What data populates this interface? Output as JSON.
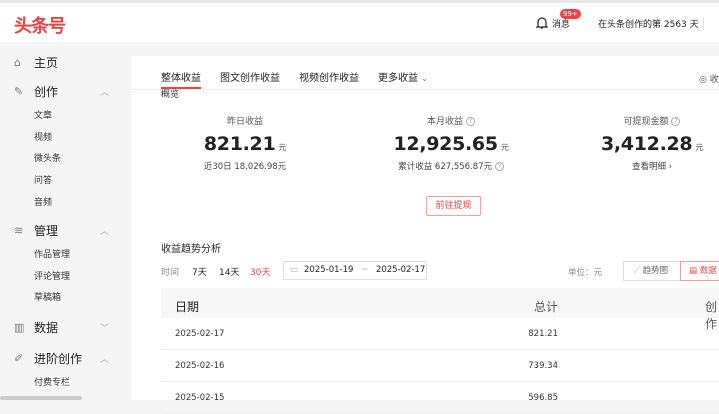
{
  "header": {
    "logo": "头条号",
    "messages": "消息",
    "badge": "99+",
    "days": "在头条创作的第 2563 天"
  },
  "sidebar": {
    "items": [
      {
        "label": "主页",
        "icon": "home-icon",
        "glyph": "⌂"
      },
      {
        "label": "创作",
        "icon": "pen-icon",
        "glyph": "✎",
        "chev": "︿",
        "subs": [
          "文章",
          "视频",
          "微头条",
          "问答",
          "音频"
        ]
      },
      {
        "label": "管理",
        "icon": "layers-icon",
        "glyph": "≋",
        "chev": "︿",
        "subs": [
          "作品管理",
          "评论管理",
          "草稿箱"
        ]
      },
      {
        "label": "数据",
        "icon": "bar-chart-icon",
        "glyph": "▥",
        "chev": "﹀"
      },
      {
        "label": "进阶创作",
        "icon": "edit-doc-icon",
        "glyph": "✐",
        "chev": "︿",
        "subs": [
          "付费专栏"
        ]
      }
    ]
  },
  "tabs": [
    "整体收益",
    "图文创作收益",
    "视频创作收益",
    "更多收益"
  ],
  "more_chev": "⌄",
  "right_top": "◎ 收",
  "overview": "概览",
  "stats": [
    {
      "label": "昨日收益",
      "value": "821.21",
      "unit": "元",
      "sub": "近30日 18,026.98元"
    },
    {
      "label": "本月收益",
      "value": "12,925.65",
      "unit": "元",
      "sub": "累计收益 627,556.87元"
    },
    {
      "label": "可提现金额",
      "value": "3,412.28",
      "unit": "元",
      "sub": "查看明细 ›"
    }
  ],
  "withdraw_button": "前往提现",
  "trend": {
    "title": "收益趋势分析",
    "time_label": "时间",
    "ranges": [
      "7天",
      "14天",
      "30天"
    ],
    "active_range": "30天",
    "start": "2025-01-19",
    "sep": "~",
    "end": "2025-02-17",
    "unit": "单位：元",
    "chart_view": "趋势图",
    "data_view": "数据"
  },
  "table": {
    "headers": [
      "日期",
      "总计",
      "创作"
    ],
    "rows": [
      [
        "2025-02-17",
        "821.21"
      ],
      [
        "2025-02-16",
        "739.34"
      ],
      [
        "2025-02-15",
        "596.85"
      ]
    ]
  },
  "colors": {
    "accent": "#f04142"
  }
}
